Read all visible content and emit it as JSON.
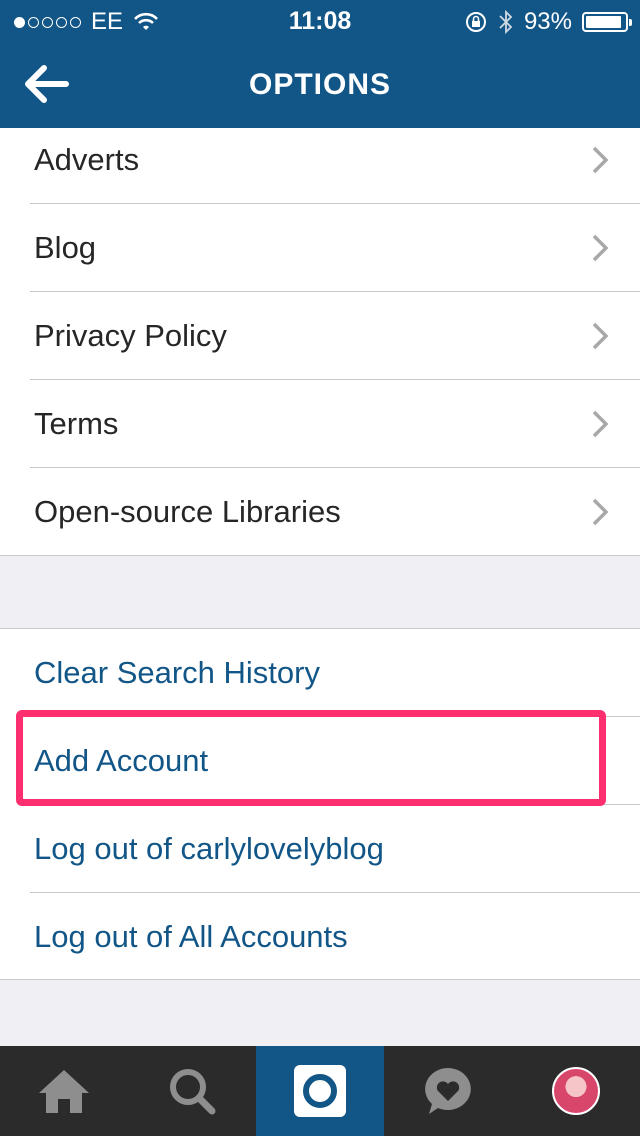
{
  "status_bar": {
    "carrier": "EE",
    "time": "11:08",
    "battery_text": "93%",
    "battery_level": 0.93,
    "signal_bars": 1
  },
  "nav": {
    "title": "OPTIONS",
    "back_icon": "back-arrow-icon"
  },
  "info_items": [
    {
      "label": "Adverts"
    },
    {
      "label": "Blog"
    },
    {
      "label": "Privacy Policy"
    },
    {
      "label": "Terms"
    },
    {
      "label": "Open-source Libraries"
    }
  ],
  "account_actions": [
    {
      "label": "Clear Search History"
    },
    {
      "label": "Add Account"
    },
    {
      "label": "Log out of carlylovelyblog"
    },
    {
      "label": "Log out of All Accounts"
    }
  ],
  "highlighted_action": "Add Account",
  "tab_bar": {
    "tabs": [
      "home-icon",
      "search-icon",
      "camera-icon",
      "activity-icon",
      "profile-avatar"
    ],
    "active": "camera-icon"
  },
  "colors": {
    "brand": "#125688",
    "highlight": "#ff2e6f",
    "tab_bar_bg": "#2b2b2b"
  }
}
